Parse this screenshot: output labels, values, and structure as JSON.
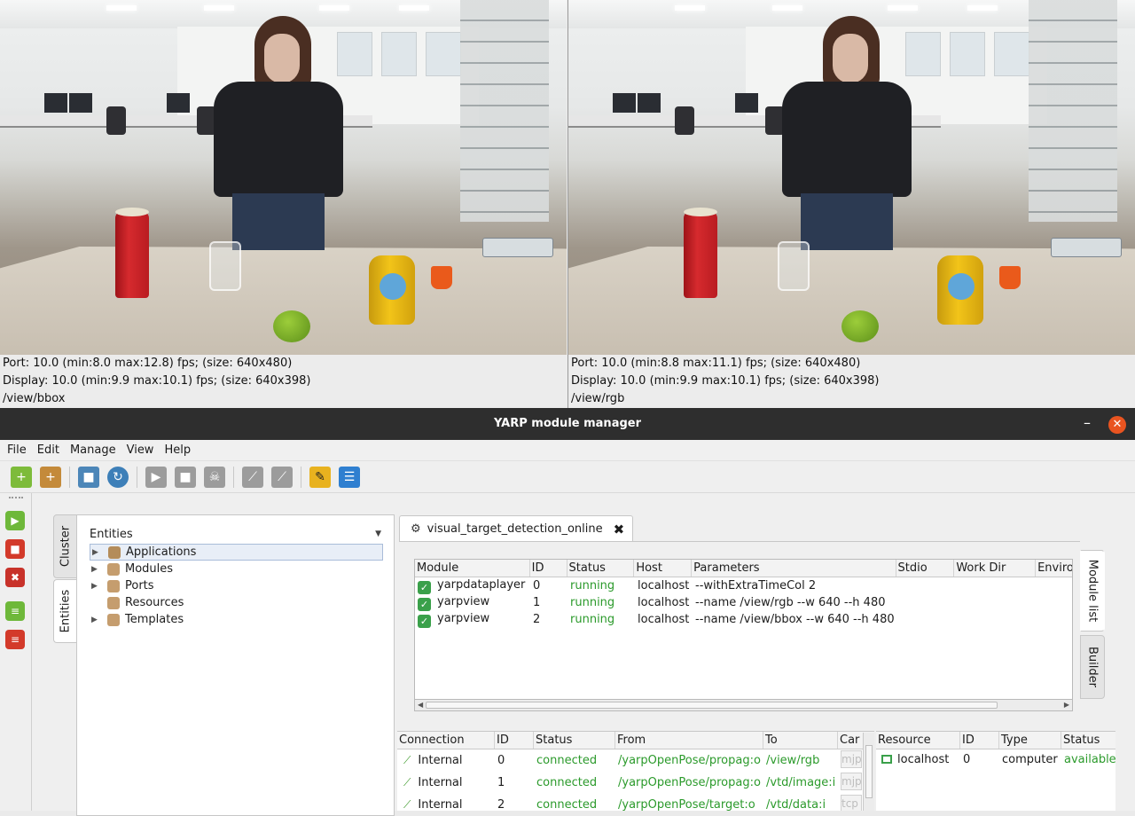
{
  "views": [
    {
      "port_info": "Port: 10.0 (min:8.0 max:12.8) fps; (size: 640x480)",
      "display_info": "Display: 10.0 (min:9.9 max:10.1) fps; (size: 640x398)",
      "name": "/view/bbox"
    },
    {
      "port_info": "Port: 10.0 (min:8.8 max:11.1) fps; (size: 640x480)",
      "display_info": "Display: 10.0 (min:9.9 max:10.1) fps; (size: 640x398)",
      "name": "/view/rgb"
    }
  ],
  "window": {
    "title": "YARP module manager",
    "minimize": "–",
    "close": "✕"
  },
  "menu": [
    "File",
    "Edit",
    "Manage",
    "View",
    "Help"
  ],
  "toolbar_icons": [
    "new-application-icon",
    "import-icon",
    "select-all-icon",
    "refresh-icon",
    "run-icon",
    "stop-icon",
    "kill-icon",
    "connect-icon",
    "disconnect-icon",
    "broom-icon",
    "list-icon"
  ],
  "sidebar_icons": [
    "run-all-icon",
    "stop-all-icon",
    "kill-all-icon",
    "connect-all-icon",
    "disconnect-all-icon"
  ],
  "left_tabs": [
    "Cluster",
    "Entities"
  ],
  "entities": {
    "header": "Entities",
    "items": [
      {
        "label": "Applications",
        "expandable": true,
        "selected": true
      },
      {
        "label": "Modules",
        "expandable": true
      },
      {
        "label": "Ports",
        "expandable": true
      },
      {
        "label": "Resources",
        "expandable": false
      },
      {
        "label": "Templates",
        "expandable": true
      }
    ]
  },
  "document_tab": {
    "label": "visual_target_detection_online",
    "close": "✖"
  },
  "module_table": {
    "headers": [
      "Module",
      "ID",
      "Status",
      "Host",
      "Parameters",
      "Stdio",
      "Work Dir",
      "Enviro"
    ],
    "rows": [
      {
        "module": "yarpdataplayer",
        "id": "0",
        "status": "running",
        "host": "localhost",
        "params": "--withExtraTimeCol 2"
      },
      {
        "module": "yarpview",
        "id": "1",
        "status": "running",
        "host": "localhost",
        "params": "--name /view/rgb --w 640 --h 480"
      },
      {
        "module": "yarpview",
        "id": "2",
        "status": "running",
        "host": "localhost",
        "params": "--name /view/bbox --w 640 --h 480"
      }
    ]
  },
  "right_tabs": [
    "Module list",
    "Builder"
  ],
  "connections": {
    "headers": [
      "Connection",
      "ID",
      "Status",
      "From",
      "To",
      "Car"
    ],
    "rows": [
      {
        "type": "Internal",
        "id": "0",
        "status": "connected",
        "from": "/yarpOpenPose/propag:o",
        "to": "/view/rgb",
        "carrier": "mjp"
      },
      {
        "type": "Internal",
        "id": "1",
        "status": "connected",
        "from": "/yarpOpenPose/propag:o",
        "to": "/vtd/image:i",
        "carrier": "mjp"
      },
      {
        "type": "Internal",
        "id": "2",
        "status": "connected",
        "from": "/yarpOpenPose/target:o",
        "to": "/vtd/data:i",
        "carrier": "tcp"
      }
    ]
  },
  "resources": {
    "headers": [
      "Resource",
      "ID",
      "Type",
      "Status"
    ],
    "rows": [
      {
        "name": "localhost",
        "id": "0",
        "type": "computer",
        "status": "available"
      }
    ]
  },
  "colors": {
    "running": "#2b9a2b",
    "titlebar": "#2e2e2e",
    "close_button": "#e95420"
  }
}
